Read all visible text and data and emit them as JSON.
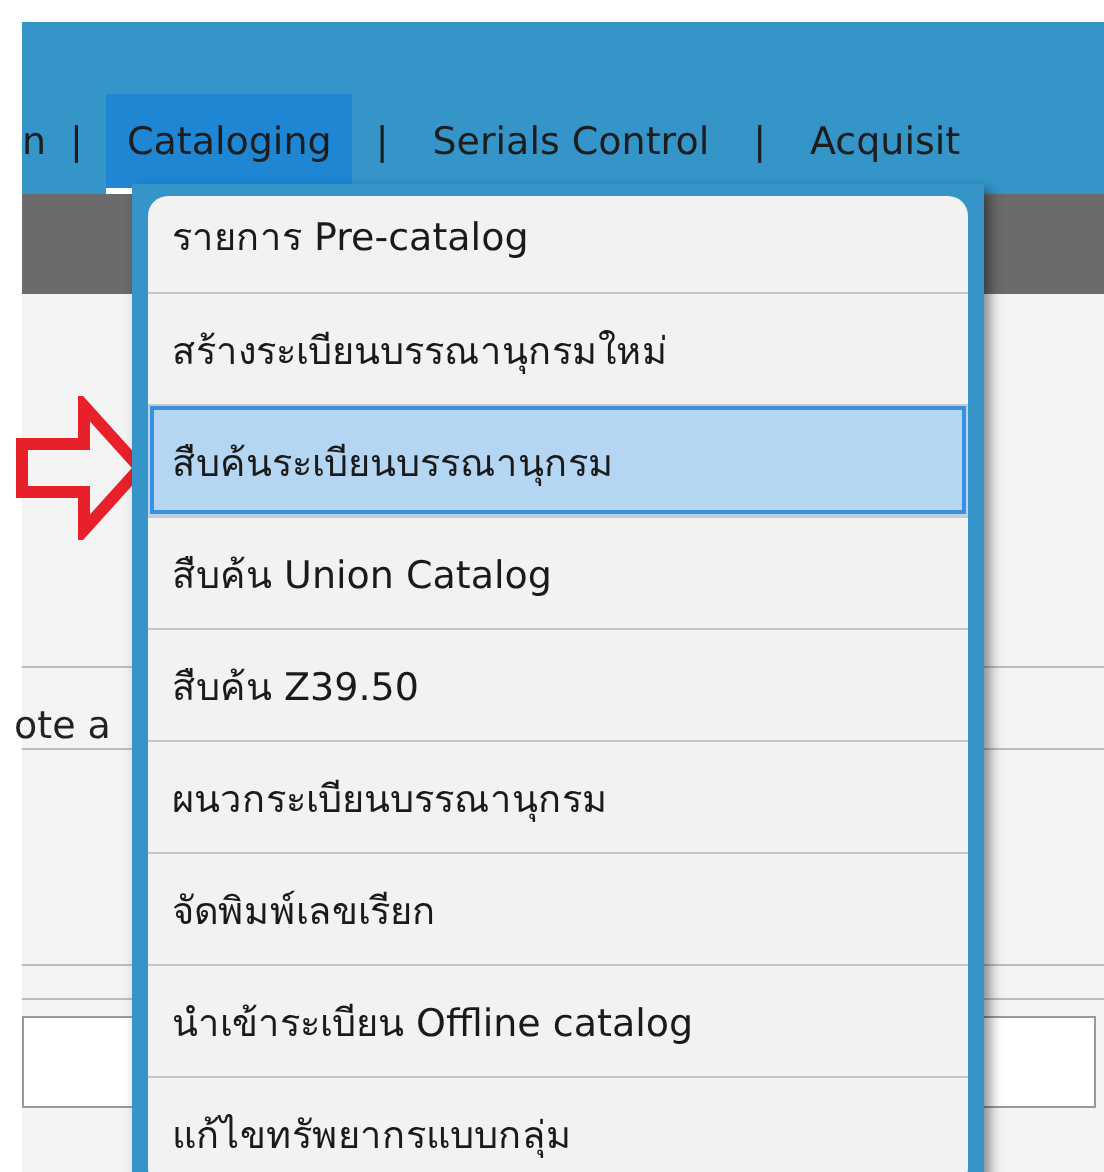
{
  "nav": [
    {
      "kind": "tab",
      "label": "n",
      "selected": false
    },
    {
      "kind": "separator",
      "label": "|"
    },
    {
      "kind": "tab",
      "label": "Cataloging",
      "selected": true
    },
    {
      "kind": "separator",
      "label": "|"
    },
    {
      "kind": "tab",
      "label": "Serials Control",
      "selected": false
    },
    {
      "kind": "separator",
      "label": "|"
    },
    {
      "kind": "tab",
      "label": "Acquisit",
      "selected": false
    }
  ],
  "menu": [
    {
      "label": "รายการ Pre-catalog",
      "selected": false
    },
    {
      "label": "สร้างระเบียนบรรณานุกรมใหม่",
      "selected": false
    },
    {
      "label": "สืบค้นระเบียนบรรณานุกรม",
      "selected": true
    },
    {
      "label": "สืบค้น Union Catalog",
      "selected": false
    },
    {
      "label": "สืบค้น Z39.50",
      "selected": false
    },
    {
      "label": "ผนวกระเบียนบรรณานุกรม",
      "selected": false
    },
    {
      "label": "จัดพิมพ์เลขเรียก",
      "selected": false
    },
    {
      "label": "นำเข้าระเบียน Offline catalog",
      "selected": false
    },
    {
      "label": "แก้ไขทรัพยากรแบบกลุ่ม",
      "selected": false
    }
  ],
  "content": {
    "partial_label": "ote a"
  }
}
